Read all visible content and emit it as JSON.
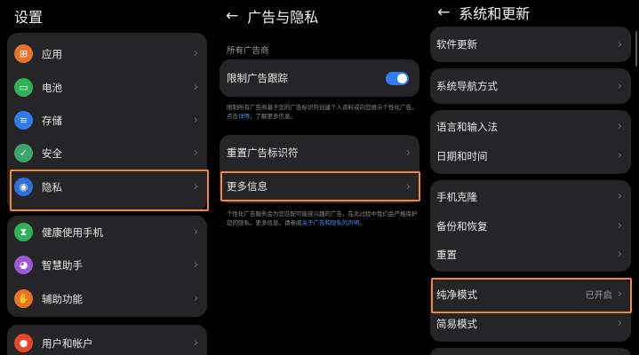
{
  "left_panel": {
    "title": "设置",
    "items": [
      {
        "label": "应用",
        "icon": "apps-icon",
        "color": "#e8732a",
        "glyph": "⊞"
      },
      {
        "label": "电池",
        "icon": "battery-icon",
        "color": "#2fb356",
        "glyph": "▭"
      },
      {
        "label": "存储",
        "icon": "storage-icon",
        "color": "#2f7df0",
        "glyph": "≡"
      },
      {
        "label": "安全",
        "icon": "shield-check-icon",
        "color": "#3aa66a",
        "glyph": "✓"
      },
      {
        "label": "隐私",
        "icon": "privacy-shield-icon",
        "color": "#2f6fd9",
        "glyph": "◉"
      },
      {
        "label": "健康使用手机",
        "icon": "hourglass-icon",
        "color": "#2fb356",
        "glyph": "⧗"
      },
      {
        "label": "智慧助手",
        "icon": "assistant-icon",
        "color": "#9b59d6",
        "glyph": "◕"
      },
      {
        "label": "辅助功能",
        "icon": "accessibility-icon",
        "color": "#e8732a",
        "glyph": "✋"
      },
      {
        "label": "用户和帐户",
        "icon": "user-icon",
        "color": "#e8452a",
        "glyph": "●"
      }
    ]
  },
  "middle_panel": {
    "title": "广告与隐私",
    "section_label": "所有广告商",
    "limit_tracking": {
      "label": "限制广告跟踪",
      "enabled": true
    },
    "note1_text": "限制所有广告商基于您的广告标识符创建个人资料或向您展示个性化广告。点击",
    "note1_link": "详情",
    "note1_tail": "，了解更多信息。",
    "reset_label": "重置广告标识符",
    "more_info_label": "更多信息",
    "note2_text": "个性化广告服务会为您匹配可能感兴趣的广告，在此过程中我们会严格保护您的隐私。更多信息，请参阅",
    "note2_link": "关于广告和隐私的声明",
    "note2_tail": "。"
  },
  "right_panel": {
    "title": "系统和更新",
    "groups": [
      [
        "软件更新"
      ],
      [
        "系统导航方式"
      ],
      [
        "语言和输入法",
        "日期和时间"
      ],
      [
        "手机克隆",
        "备份和恢复",
        "重置"
      ],
      [
        "纯净模式",
        "简易模式"
      ]
    ],
    "pure_mode_status": "已开启"
  },
  "colors": {
    "accent": "#2f7df0",
    "highlight": "#f08a3a",
    "card": "#252527"
  }
}
